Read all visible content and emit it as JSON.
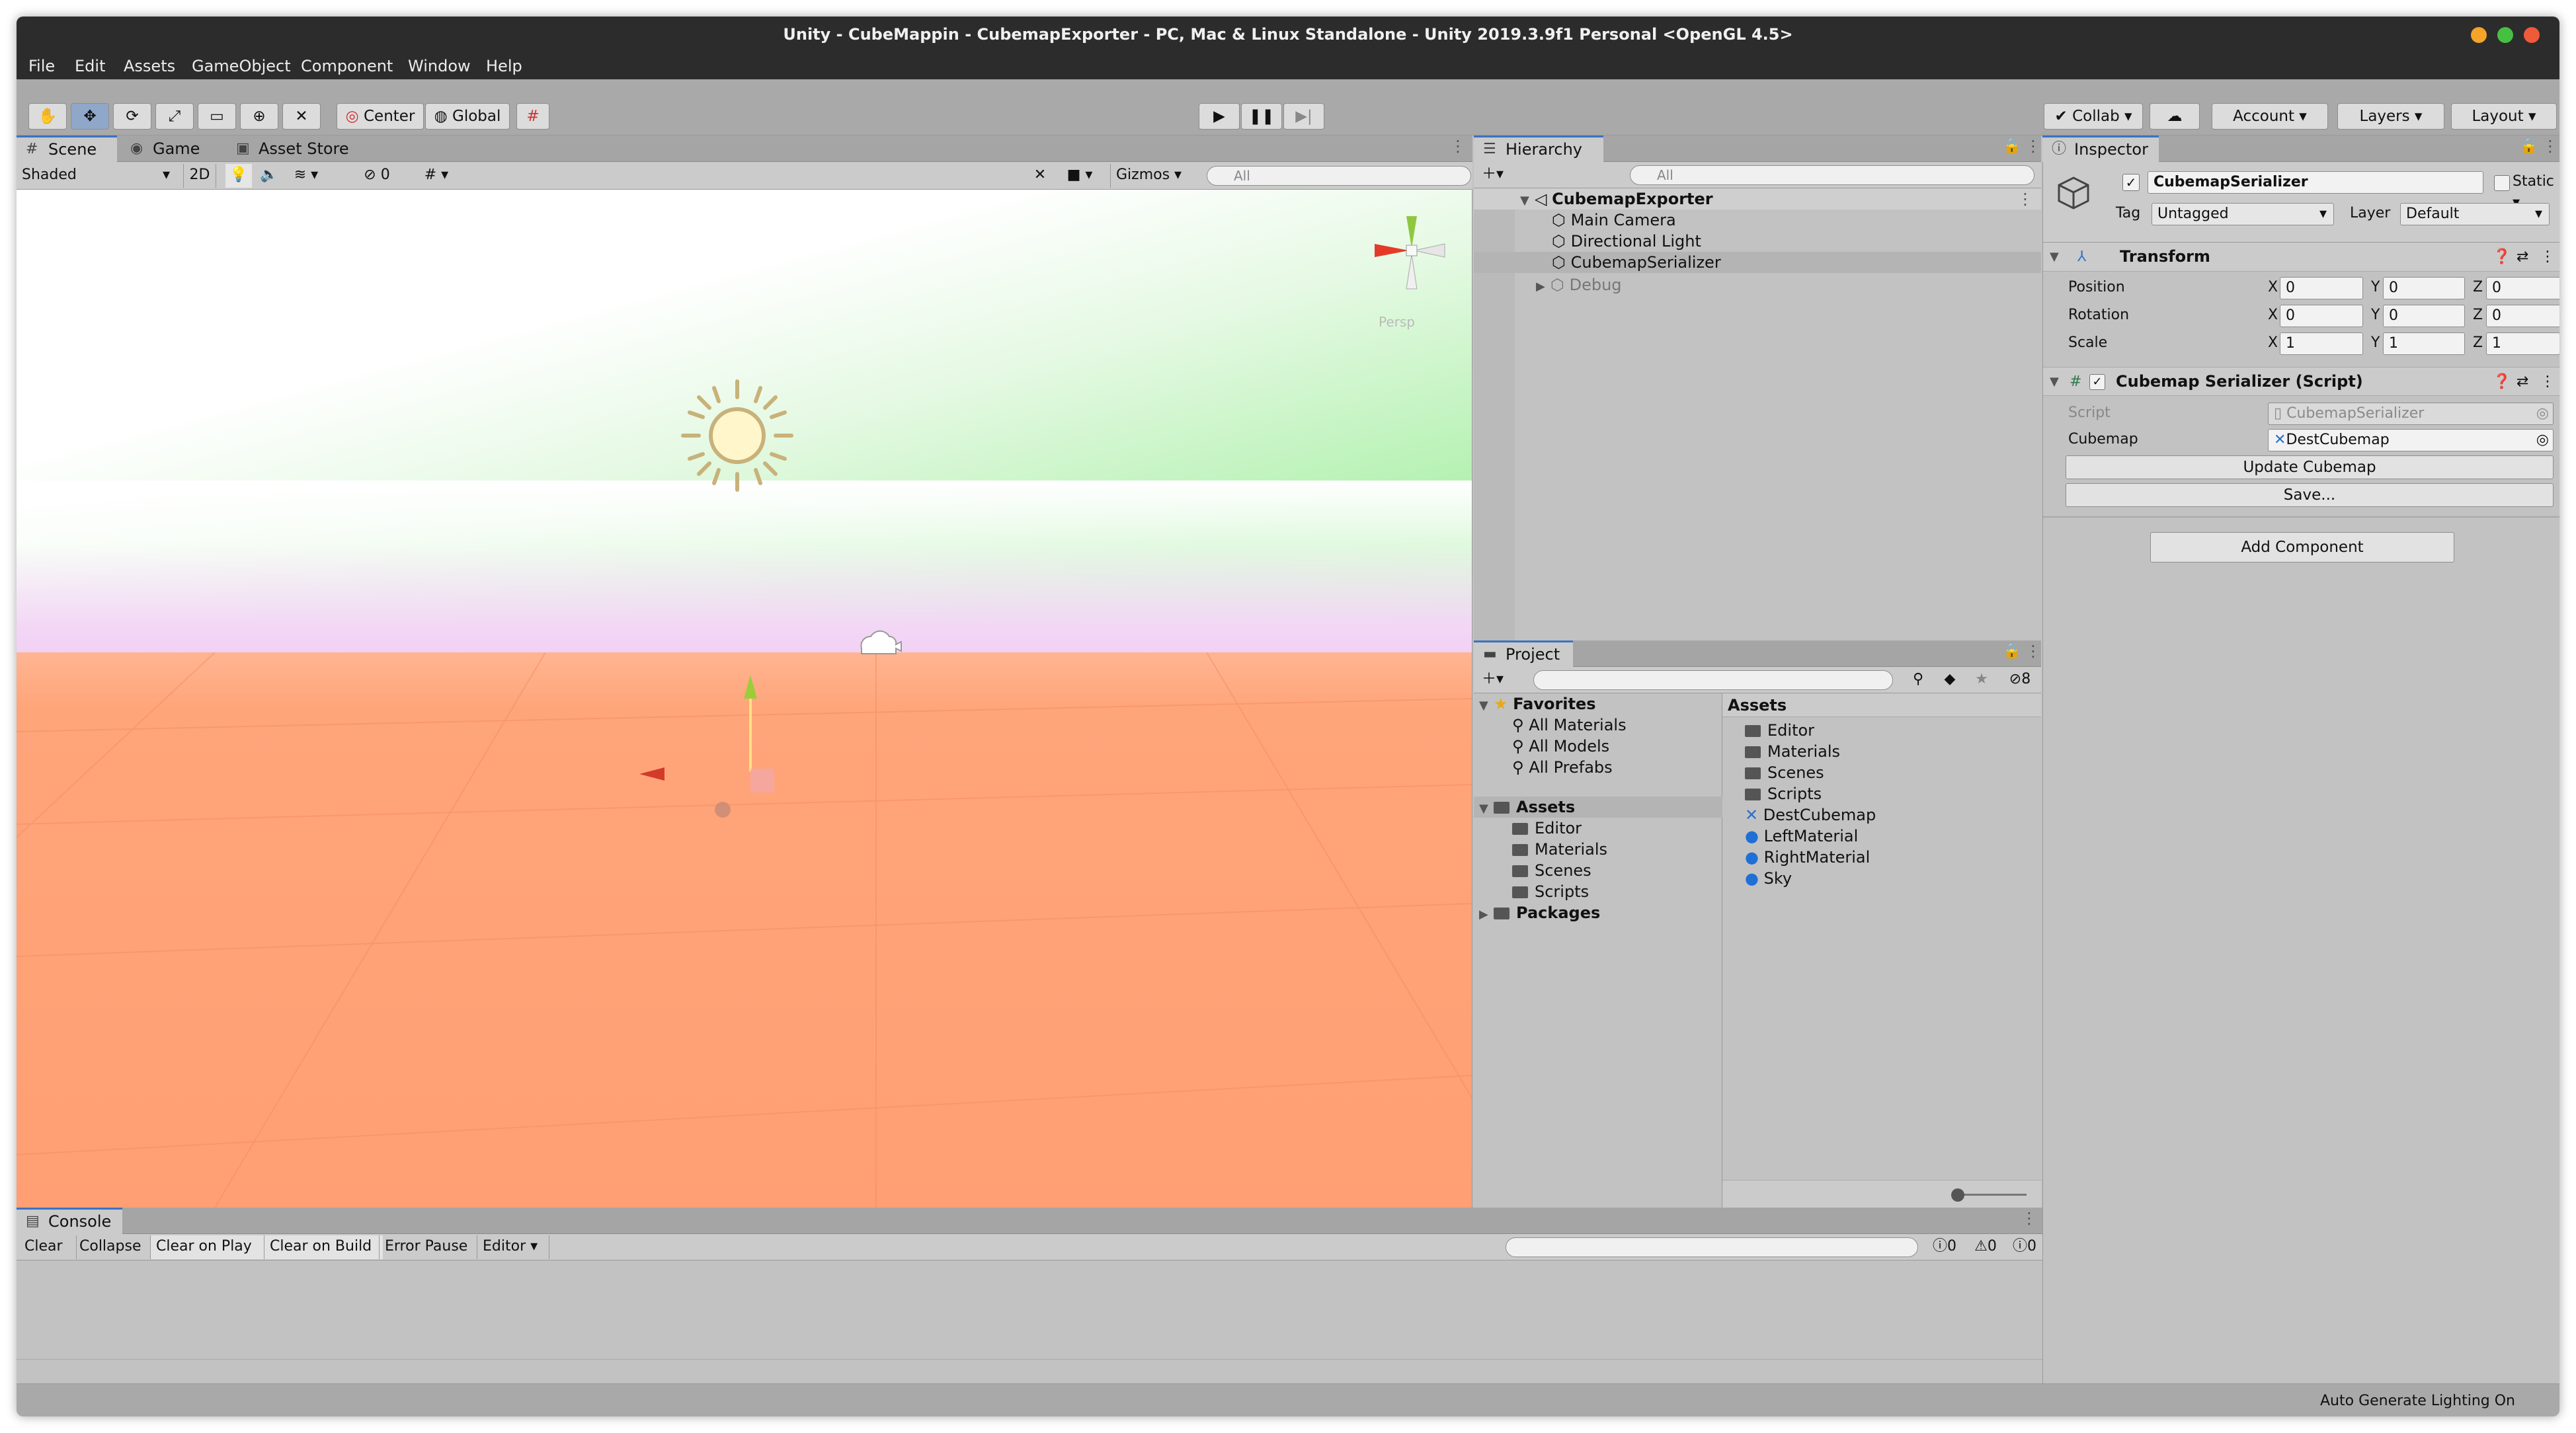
{
  "window": {
    "title": "Unity - CubeMappin - CubemapExporter - PC, Mac & Linux Standalone - Unity 2019.3.9f1 Personal <OpenGL 4.5>"
  },
  "menu": [
    "File",
    "Edit",
    "Assets",
    "GameObject",
    "Component",
    "Window",
    "Help"
  ],
  "toolbar": {
    "pivot": "Center",
    "space": "Global",
    "collab": "Collab",
    "account": "Account",
    "layers": "Layers",
    "layout": "Layout"
  },
  "scene": {
    "tabs": [
      "Scene",
      "Game",
      "Asset Store"
    ],
    "shading": "Shaded",
    "mode_2d": "2D",
    "hidden_count": "0",
    "gizmos": "Gizmos",
    "search_placeholder": "All",
    "persp": "Persp"
  },
  "hierarchy": {
    "tab": "Hierarchy",
    "search_placeholder": "All",
    "scene": "CubemapExporter",
    "items": [
      "Main Camera",
      "Directional Light",
      "CubemapSerializer",
      "Debug"
    ]
  },
  "project": {
    "tab": "Project",
    "hidden_count": "8",
    "favorites": "Favorites",
    "favorite_items": [
      "All Materials",
      "All Models",
      "All Prefabs"
    ],
    "assets": "Assets",
    "asset_folders": [
      "Editor",
      "Materials",
      "Scenes",
      "Scripts"
    ],
    "packages": "Packages",
    "content_header": "Assets",
    "content_items": [
      "Editor",
      "Materials",
      "Scenes",
      "Scripts",
      "DestCubemap",
      "LeftMaterial",
      "RightMaterial",
      "Sky"
    ]
  },
  "inspector": {
    "tab": "Inspector",
    "object_name": "CubemapSerializer",
    "static_label": "Static",
    "tag_label": "Tag",
    "tag_value": "Untagged",
    "layer_label": "Layer",
    "layer_value": "Default",
    "transform": {
      "title": "Transform",
      "position_label": "Position",
      "rotation_label": "Rotation",
      "scale_label": "Scale",
      "axis_x": "X",
      "axis_y": "Y",
      "axis_z": "Z",
      "position": [
        "0",
        "0",
        "0"
      ],
      "rotation": [
        "0",
        "0",
        "0"
      ],
      "scale": [
        "1",
        "1",
        "1"
      ]
    },
    "script_component": {
      "title": "Cubemap Serializer (Script)",
      "script_label": "Script",
      "script_value": "CubemapSerializer",
      "cubemap_label": "Cubemap",
      "cubemap_value": "DestCubemap",
      "update_button": "Update Cubemap",
      "save_button": "Save..."
    },
    "add_component": "Add Component"
  },
  "console": {
    "tab": "Console",
    "buttons": [
      "Clear",
      "Collapse",
      "Clear on Play",
      "Clear on Build",
      "Error Pause",
      "Editor"
    ],
    "error_count": "0",
    "warning_count": "0",
    "info_count": "0"
  },
  "status": {
    "text": "Auto Generate Lighting On"
  },
  "colors": {
    "accent": "#3a72c4",
    "selection": "#b4b4b4",
    "sky_top": "#b6f2b6",
    "horizon": "#f3c8f3",
    "ground": "#ff9f71"
  }
}
